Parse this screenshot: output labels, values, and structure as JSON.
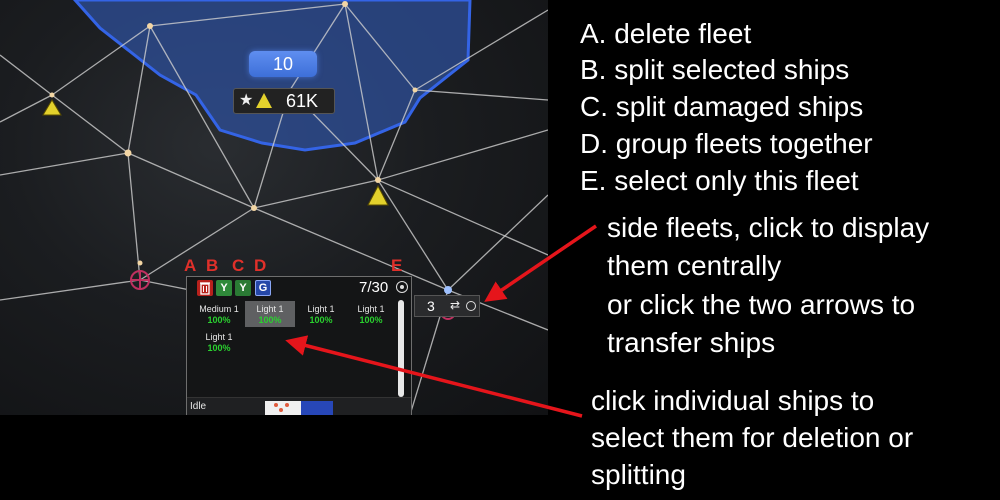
{
  "map": {
    "fleet_badge": "10",
    "strength_value": "61K",
    "star_icon": "star-icon",
    "triangle_icon": "triangle-icon",
    "colors": {
      "territory": "#2d4f9a",
      "territory_border": "#3464e6",
      "node": "#f3d6a4",
      "warning_tri": "#e3d12c"
    }
  },
  "callout_letters": {
    "a": "A",
    "b": "B",
    "c": "C",
    "d": "D",
    "e": "E"
  },
  "fleet_panel": {
    "toolbar_buttons": {
      "delete": {
        "icon": "trash-icon"
      },
      "split_selected": {
        "icon": "split-icon",
        "glyph": "Y"
      },
      "split_damaged": {
        "icon": "split-damaged-icon",
        "glyph": "Y"
      },
      "group": {
        "icon": "group-icon",
        "glyph": "G"
      },
      "select_only": {
        "icon": "eye-icon"
      }
    },
    "count": "7/30",
    "ships": [
      {
        "class": "Medium 1",
        "hp": "100%"
      },
      {
        "class": "Light 1",
        "hp": "100%"
      },
      {
        "class": "Light 1",
        "hp": "100%"
      },
      {
        "class": "Light 1",
        "hp": "100%"
      },
      {
        "class": "Light 1",
        "hp": "100%"
      }
    ],
    "status": "Idle"
  },
  "side_fleet": {
    "count": "3",
    "arrows": "⇄"
  },
  "instructions": {
    "line_a": "A. delete fleet",
    "line_b": "B. split selected ships",
    "line_c": "C. split damaged ships",
    "line_d": "D. group fleets together",
    "line_e": "E. select only this fleet",
    "side_1": "side fleets, click to display",
    "side_2": "them centrally",
    "side_3": "or click the two arrows to",
    "side_4": "transfer ships",
    "ships_1": "click individual ships to",
    "ships_2": "select them for deletion or",
    "ships_3": "splitting"
  }
}
